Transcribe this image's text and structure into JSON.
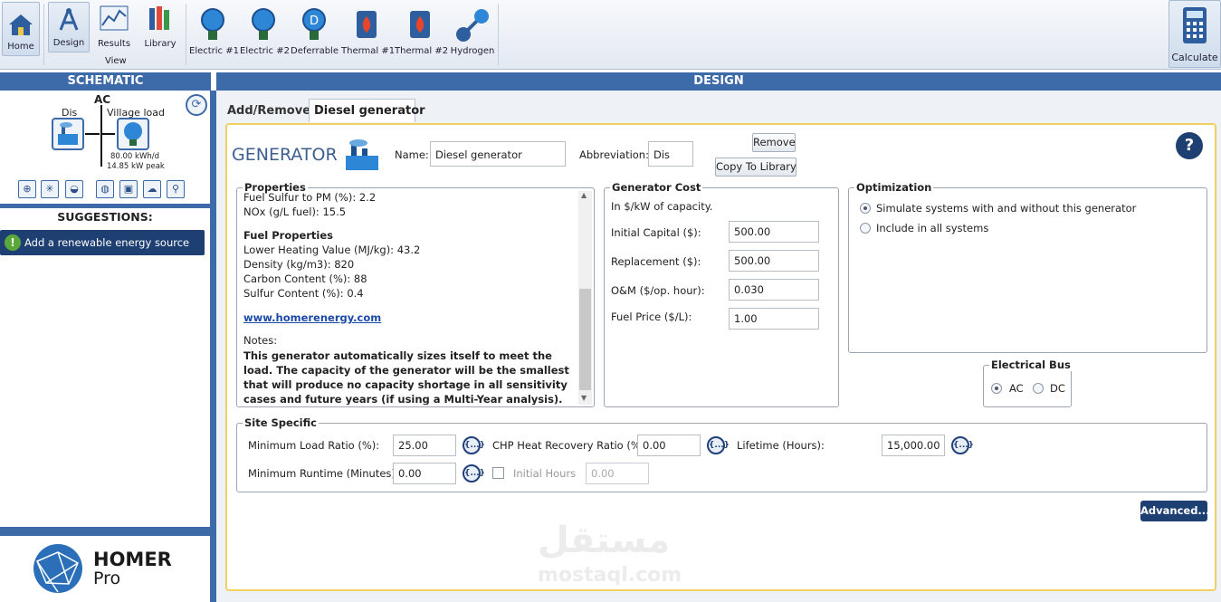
{
  "ribbon": {
    "home": "Home",
    "view_group": "View",
    "design": "Design",
    "results": "Results",
    "library": "Library",
    "loads": [
      {
        "label": "Electric #1",
        "icon": "bulb-icon"
      },
      {
        "label": "Electric #2",
        "icon": "bulb-icon"
      },
      {
        "label": "Deferrable",
        "icon": "bulb-d-icon"
      },
      {
        "label": "Thermal #1",
        "icon": "flame-icon"
      },
      {
        "label": "Thermal #2",
        "icon": "flame-icon"
      },
      {
        "label": "Hydrogen",
        "icon": "molecule-icon"
      }
    ],
    "calculate": "Calculate"
  },
  "headers": {
    "schematic": "SCHEMATIC",
    "design": "DESIGN"
  },
  "schematic": {
    "bus": "AC",
    "gen_label": "Dis",
    "load_label": "Village load",
    "load_energy": "80.00 kWh/d",
    "load_peak": "14.85 kW peak"
  },
  "suggestions": {
    "title": "SUGGESTIONS:",
    "items": [
      "Add a renewable energy source"
    ]
  },
  "logo": {
    "line1": "HOMER",
    "line2": "Pro"
  },
  "tabs": [
    "Add/Remove",
    "Diesel generator"
  ],
  "generator": {
    "title": "GENERATOR",
    "name_label": "Name:",
    "name_value": "Diesel generator",
    "abbrev_label": "Abbreviation:",
    "abbrev_value": "Dis",
    "remove": "Remove",
    "copy": "Copy To Library",
    "help": "?"
  },
  "properties": {
    "legend": "Properties",
    "line1": "Fuel Sulfur to PM (%):  2.2",
    "line2": "NOx (g/L fuel): 15.5",
    "fuel_heading": "Fuel Properties",
    "fuel1": "Lower Heating Value (MJ/kg): 43.2",
    "fuel2": "Density (kg/m3): 820",
    "fuel3": "Carbon Content (%): 88",
    "fuel4": "Sulfur Content (%): 0.4",
    "link": "www.homerenergy.com",
    "notes_label": "Notes:",
    "notes": "This generator automatically sizes itself to meet the load. The capacity of the generator will be the smallest that will produce no capacity shortage in all sensitivity cases and future years (if using a Multi-Year analysis). It also adjusts its fuel curve to match its size."
  },
  "cost": {
    "legend": "Generator Cost",
    "unit_note": "In $/kW of capacity.",
    "capital_label": "Initial Capital ($):",
    "capital": "500.00",
    "replacement_label": "Replacement ($):",
    "replacement": "500.00",
    "om_label": "O&M ($/op. hour):",
    "om": "0.030",
    "fuel_label": "Fuel Price ($/L):",
    "fuel": "1.00"
  },
  "optimization": {
    "legend": "Optimization",
    "opt1": "Simulate systems with and without this generator",
    "opt2": "Include in all systems",
    "selected": 1
  },
  "bus": {
    "legend": "Electrical Bus",
    "ac": "AC",
    "dc": "DC",
    "selected": "AC"
  },
  "site": {
    "legend": "Site Specific",
    "min_load_label": "Minimum Load Ratio (%):",
    "min_load": "25.00",
    "chp_label": "CHP Heat Recovery Ratio (%):",
    "chp": "0.00",
    "lifetime_label": "Lifetime (Hours):",
    "lifetime": "15,000.00",
    "min_runtime_label": "Minimum Runtime (Minutes):",
    "min_runtime": "0.00",
    "initial_hours_label": "Initial Hours",
    "initial_hours": "0.00",
    "dots": "{...}"
  },
  "advanced": "Advanced...",
  "watermark": {
    "arabic": "مستقل",
    "latin": "mostaql.com"
  }
}
